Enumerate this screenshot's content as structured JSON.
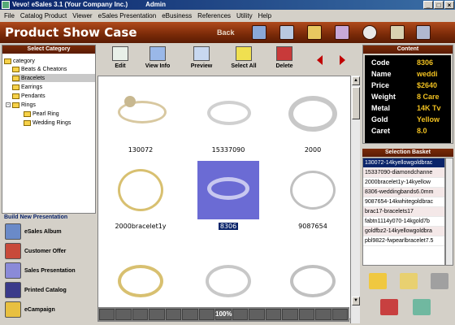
{
  "window": {
    "title": "Vevo! eSales 3.1 (Your Company Inc.)",
    "user": "Admin",
    "min_glyph": "_",
    "max_glyph": "□",
    "close_glyph": "×"
  },
  "menu": [
    "File",
    "Catalog Product",
    "Viewer",
    "eSales Presentation",
    "eBusiness",
    "References",
    "Utility",
    "Help"
  ],
  "header": {
    "title": "Product Show Case",
    "back_label": "Back"
  },
  "category_panel": {
    "title": "Select Category",
    "root": "category",
    "items": [
      "Beats & Cheatons",
      "Bracelets",
      "Earrings",
      "Pendants",
      "Rings",
      "Pearl Ring",
      "Wedding Rings"
    ],
    "selected": "Bracelets"
  },
  "presentation": {
    "title": "Build New Presentation",
    "items": [
      "eSales Album",
      "Customer Offer",
      "Sales Presentation",
      "Printed Catalog",
      "eCampaign"
    ]
  },
  "toolbar": {
    "buttons": [
      "Edit",
      "View Info",
      "Preview",
      "Select All",
      "Delete"
    ]
  },
  "gallery": {
    "items": [
      "130072",
      "15337090",
      "2000",
      "2000bracelet1y",
      "8306",
      "9087654",
      "",
      "",
      ""
    ],
    "selected": "8306"
  },
  "status": {
    "zoom": "100%"
  },
  "content": {
    "title": "Content",
    "fields": [
      {
        "key": "Code",
        "value": "8306"
      },
      {
        "key": "Name",
        "value": "weddi"
      },
      {
        "key": "Price",
        "value": "$2640"
      },
      {
        "key": "Weight",
        "value": "8 Care"
      },
      {
        "key": "Metal",
        "value": "14K Tv"
      },
      {
        "key": "Gold",
        "value": "Yellow"
      },
      {
        "key": "Caret",
        "value": "8.0"
      }
    ]
  },
  "basket": {
    "title": "Selection Basket",
    "items": [
      "130072-14kyellowgoldbrac",
      "15337090-diamondchanne",
      "2000bracelet1y-14kyellow",
      "8306-weddingbands6.0mm",
      "9087654-14kwhitegoldbrac",
      "brac17-bracelets17",
      "fabtn1114y070-14kgold7b",
      "goldfbz2-14kyellowgoldbra",
      "pbl9822-fwpearlbracelet7.5"
    ],
    "selected_index": 0
  },
  "colors": {
    "brand": "#7a2a08",
    "selection": "#0a246a",
    "content_value": "#f0c020"
  }
}
